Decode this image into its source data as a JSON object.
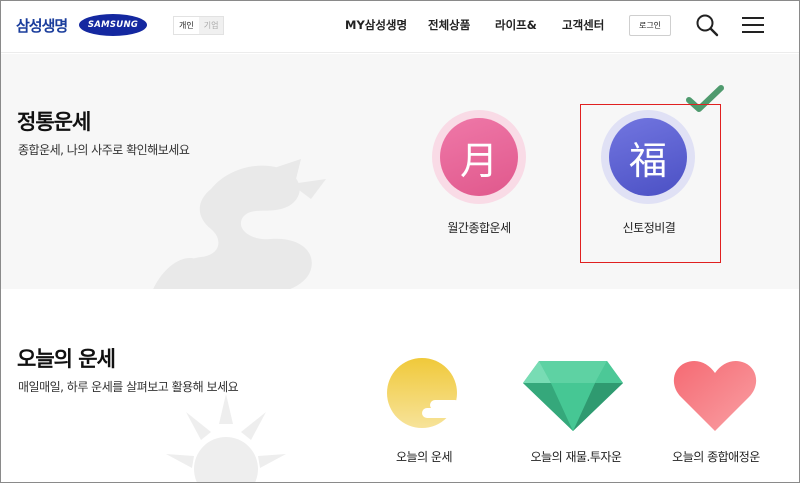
{
  "header": {
    "brand": "삼성생명",
    "partner_logo": "SAMSUNG",
    "customer_toggle": {
      "personal": "개인",
      "corporate": "기업"
    },
    "nav": [
      "MY삼성생명",
      "전체상품",
      "라이프&",
      "고객센터"
    ],
    "login": "로그인",
    "icons": [
      "search-icon",
      "menu-icon"
    ]
  },
  "section_traditional": {
    "title": "정통운세",
    "subtitle": "종합운세, 나의 사주로 확인해보세요",
    "items": [
      {
        "label": "월간종합운세",
        "glyph": "月",
        "color": "#e7639a"
      },
      {
        "label": "신토정비결",
        "glyph": "福",
        "color": "#5a5fd0"
      }
    ],
    "selected_mark": "checkmark-icon"
  },
  "section_today": {
    "title": "오늘의 운세",
    "subtitle": "매일매일, 하루 운세를 살펴보고 활용해 보세요",
    "items": [
      {
        "label": "오늘의 운세",
        "icon": "sun-cloud-icon",
        "color": "#f0cc3c"
      },
      {
        "label": "오늘의 재물.투자운",
        "icon": "gem-icon",
        "color": "#3fc08d"
      },
      {
        "label": "오늘의 종합애정운",
        "icon": "heart-icon",
        "color": "#f0737a"
      }
    ]
  }
}
